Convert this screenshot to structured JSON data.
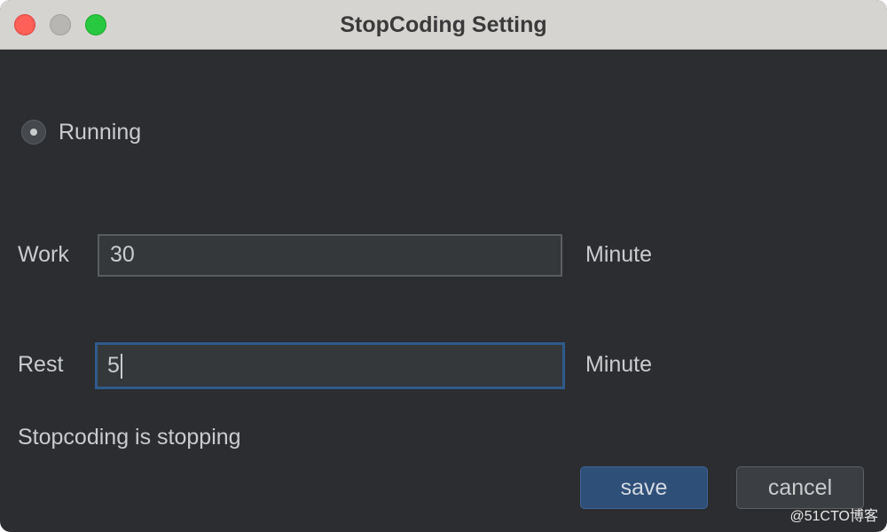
{
  "window": {
    "title": "StopCoding Setting"
  },
  "radio": {
    "label": "Running",
    "selected": true
  },
  "work": {
    "label": "Work",
    "value": "30",
    "unit": "Minute"
  },
  "rest": {
    "label": "Rest",
    "value": "5",
    "unit": "Minute"
  },
  "status": {
    "text": "Stopcoding is stopping"
  },
  "buttons": {
    "save_label": "save",
    "cancel_label": "cancel"
  },
  "watermark": {
    "text": "@51CTO博客"
  },
  "colors": {
    "background": "#2b2d30",
    "titlebar": "#d6d4d1",
    "accent": "#2e4f78",
    "focus_border": "#2f5a8c",
    "text": "#c9cbcd"
  }
}
